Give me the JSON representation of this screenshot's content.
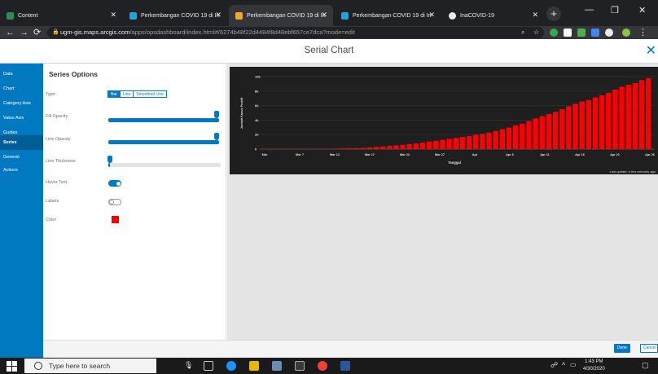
{
  "browser": {
    "tabs": [
      {
        "title": "Content",
        "active": false
      },
      {
        "title": "Perkembangan COVID 19 di In",
        "active": false
      },
      {
        "title": "Perkembangan COVID 19 di In",
        "active": true
      },
      {
        "title": "Perkembangan COVID 19 di In",
        "active": false
      },
      {
        "title": "InaCOVID-19",
        "active": false
      }
    ],
    "url_host": "ugm-gis.maps.arcgis.com",
    "url_path": "/apps/opsdashboard/index.html#/6274b48f22d4484f8d48ebf657ce7dca?mode=edit"
  },
  "dialog": {
    "title": "Serial Chart",
    "nav": [
      "Data",
      "Chart",
      "Category Axis",
      "Value Axis",
      "Guides",
      "Series",
      "General",
      "Actions"
    ],
    "nav_active": "Series"
  },
  "series_options": {
    "heading": "Series Options",
    "type_label": "Type",
    "type_options": [
      "Bar",
      "Line",
      "Smoothed Line"
    ],
    "type_selected": "Bar",
    "fill_opacity_label": "Fill Opacity",
    "fill_opacity": 1.0,
    "line_opacity_label": "Line Opacity",
    "line_opacity": 1.0,
    "line_thickness_label": "Line Thickness",
    "line_thickness": 0.0,
    "hover_text_label": "Hover Text",
    "hover_text_on": true,
    "labels_label": "Labels",
    "labels_on": false,
    "color_label": "Color",
    "color": "#ff0000"
  },
  "chart_data": {
    "type": "bar",
    "ylabel": "Jumlah Kasus Positif",
    "xlabel": "Tanggal",
    "ylim": [
      0,
      10000
    ],
    "yticks": [
      "0",
      "2k",
      "4k",
      "6k",
      "8k",
      "10k"
    ],
    "xticks": [
      "Mar",
      "Mar 7",
      "Mar 12",
      "Mar 17",
      "Mar 22",
      "Mar 27",
      "Apr",
      "Apr 6",
      "Apr 11",
      "Apr 16",
      "Apr 21",
      "Apr 26"
    ],
    "series": [
      {
        "name": "",
        "color": "#ff0000",
        "values": [
          2,
          2,
          2,
          2,
          4,
          4,
          6,
          19,
          27,
          34,
          34,
          69,
          96,
          117,
          134,
          172,
          227,
          309,
          369,
          450,
          514,
          579,
          686,
          790,
          893,
          1046,
          1155,
          1285,
          1414,
          1528,
          1677,
          1790,
          1986,
          2092,
          2273,
          2491,
          2738,
          2956,
          3293,
          3512,
          3842,
          4241,
          4557,
          4839,
          5136,
          5516,
          5923,
          6248,
          6575,
          6760,
          7135,
          7418,
          7775,
          8211,
          8607,
          8882,
          9096,
          9511,
          9771
        ]
      }
    ],
    "footnote": "Last update: a few seconds ago"
  },
  "footer": {
    "done": "Done",
    "cancel": "Cancel"
  },
  "taskbar": {
    "search_placeholder": "Type here to search",
    "time": "1:43 PM",
    "date": "4/30/2020"
  }
}
